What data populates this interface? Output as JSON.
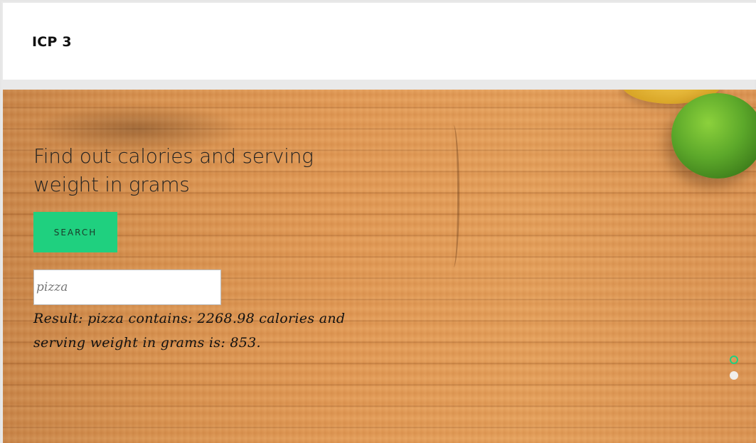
{
  "header": {
    "brand": "ICP 3"
  },
  "hero": {
    "headline": "Find out calories and serving weight in grams",
    "search_button_label": "SEARCH",
    "search_input_value": "pizza",
    "result_text": "Result: pizza contains: 2268.98 calories and serving weight in grams is: 853.",
    "slider_dots": [
      "active",
      "inactive"
    ]
  },
  "colors": {
    "accent": "#1fd07f",
    "header_bg": "#ffffff",
    "wood": "#e39a55"
  }
}
